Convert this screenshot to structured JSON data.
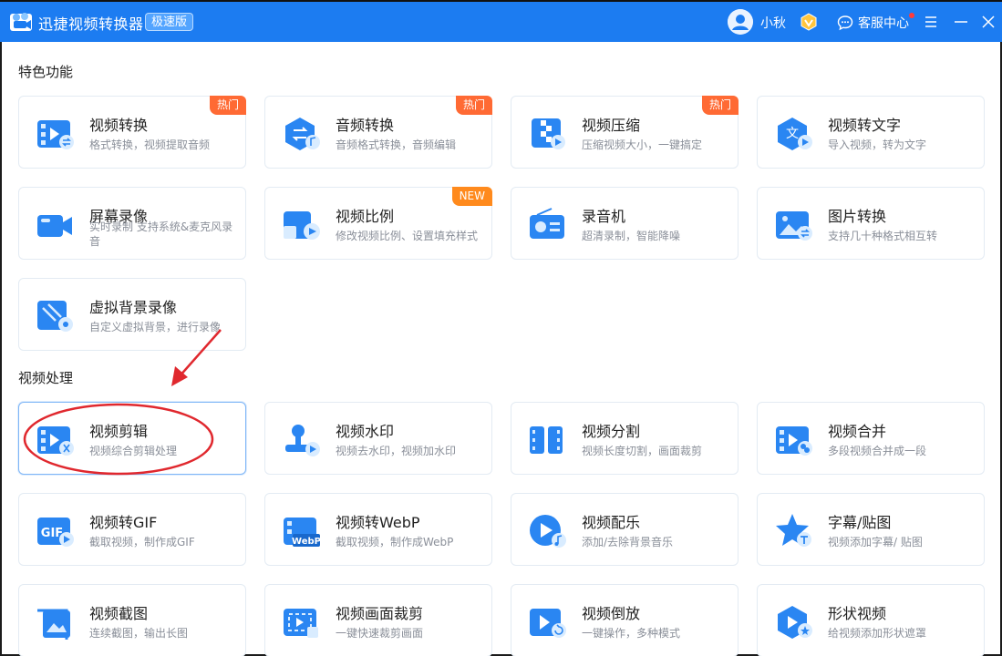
{
  "titlebar": {
    "app_title": "迅捷视频转换器",
    "edition": "极速版",
    "user_name": "小秋",
    "support_label": "客服中心",
    "accent_color": "#1c7cf1"
  },
  "sections": {
    "featured_title": "特色功能",
    "processing_title": "视频处理"
  },
  "featured": [
    {
      "title": "视频转换",
      "desc": "格式转换，视频提取音频",
      "tag": "热门"
    },
    {
      "title": "音频转换",
      "desc": "音频格式转换，音频编辑",
      "tag": "热门"
    },
    {
      "title": "视频压缩",
      "desc": "压缩视频大小，一键搞定",
      "tag": "热门"
    },
    {
      "title": "视频转文字",
      "desc": "导入视频，转为文字",
      "tag": ""
    },
    {
      "title": "屏幕录像",
      "desc": "实时录制 支持系统&麦克风录音",
      "tag": ""
    },
    {
      "title": "视频比例",
      "desc": "修改视频比例、设置填充样式",
      "tag": "NEW"
    },
    {
      "title": "录音机",
      "desc": "超清录制，智能降噪",
      "tag": ""
    },
    {
      "title": "图片转换",
      "desc": "支持几十种格式相互转",
      "tag": ""
    },
    {
      "title": "虚拟背景录像",
      "desc": "自定义虚拟背景，进行录像",
      "tag": ""
    }
  ],
  "processing": [
    {
      "title": "视频剪辑",
      "desc": "视频综合剪辑处理"
    },
    {
      "title": "视频水印",
      "desc": "视频去水印，视频加水印"
    },
    {
      "title": "视频分割",
      "desc": "视频长度切割，画面裁剪"
    },
    {
      "title": "视频合并",
      "desc": "多段视频合并成一段"
    },
    {
      "title": "视频转GIF",
      "desc": "截取视频，制作成GIF"
    },
    {
      "title": "视频转WebP",
      "desc": "截取视频，制作成WebP"
    },
    {
      "title": "视频配乐",
      "desc": "添加/去除背景音乐"
    },
    {
      "title": "字幕/贴图",
      "desc": "视频添加字幕/ 贴图"
    },
    {
      "title": "视频截图",
      "desc": "连续截图，输出长图"
    },
    {
      "title": "视频画面裁剪",
      "desc": "一键快速裁剪画面"
    },
    {
      "title": "视频倒放",
      "desc": "一键操作，多种模式"
    },
    {
      "title": "形状视频",
      "desc": "给视频添加形状遮罩"
    }
  ],
  "icon_text": {
    "gif": "GIF",
    "webp": "WebP",
    "translate": "文"
  },
  "colors": {
    "icon_blue": "#2a86f2",
    "icon_light": "#d9ecff",
    "hot_tag": "#ff6a34",
    "new_tag": "#ff8a1d",
    "annotation_red": "#e0282e"
  }
}
